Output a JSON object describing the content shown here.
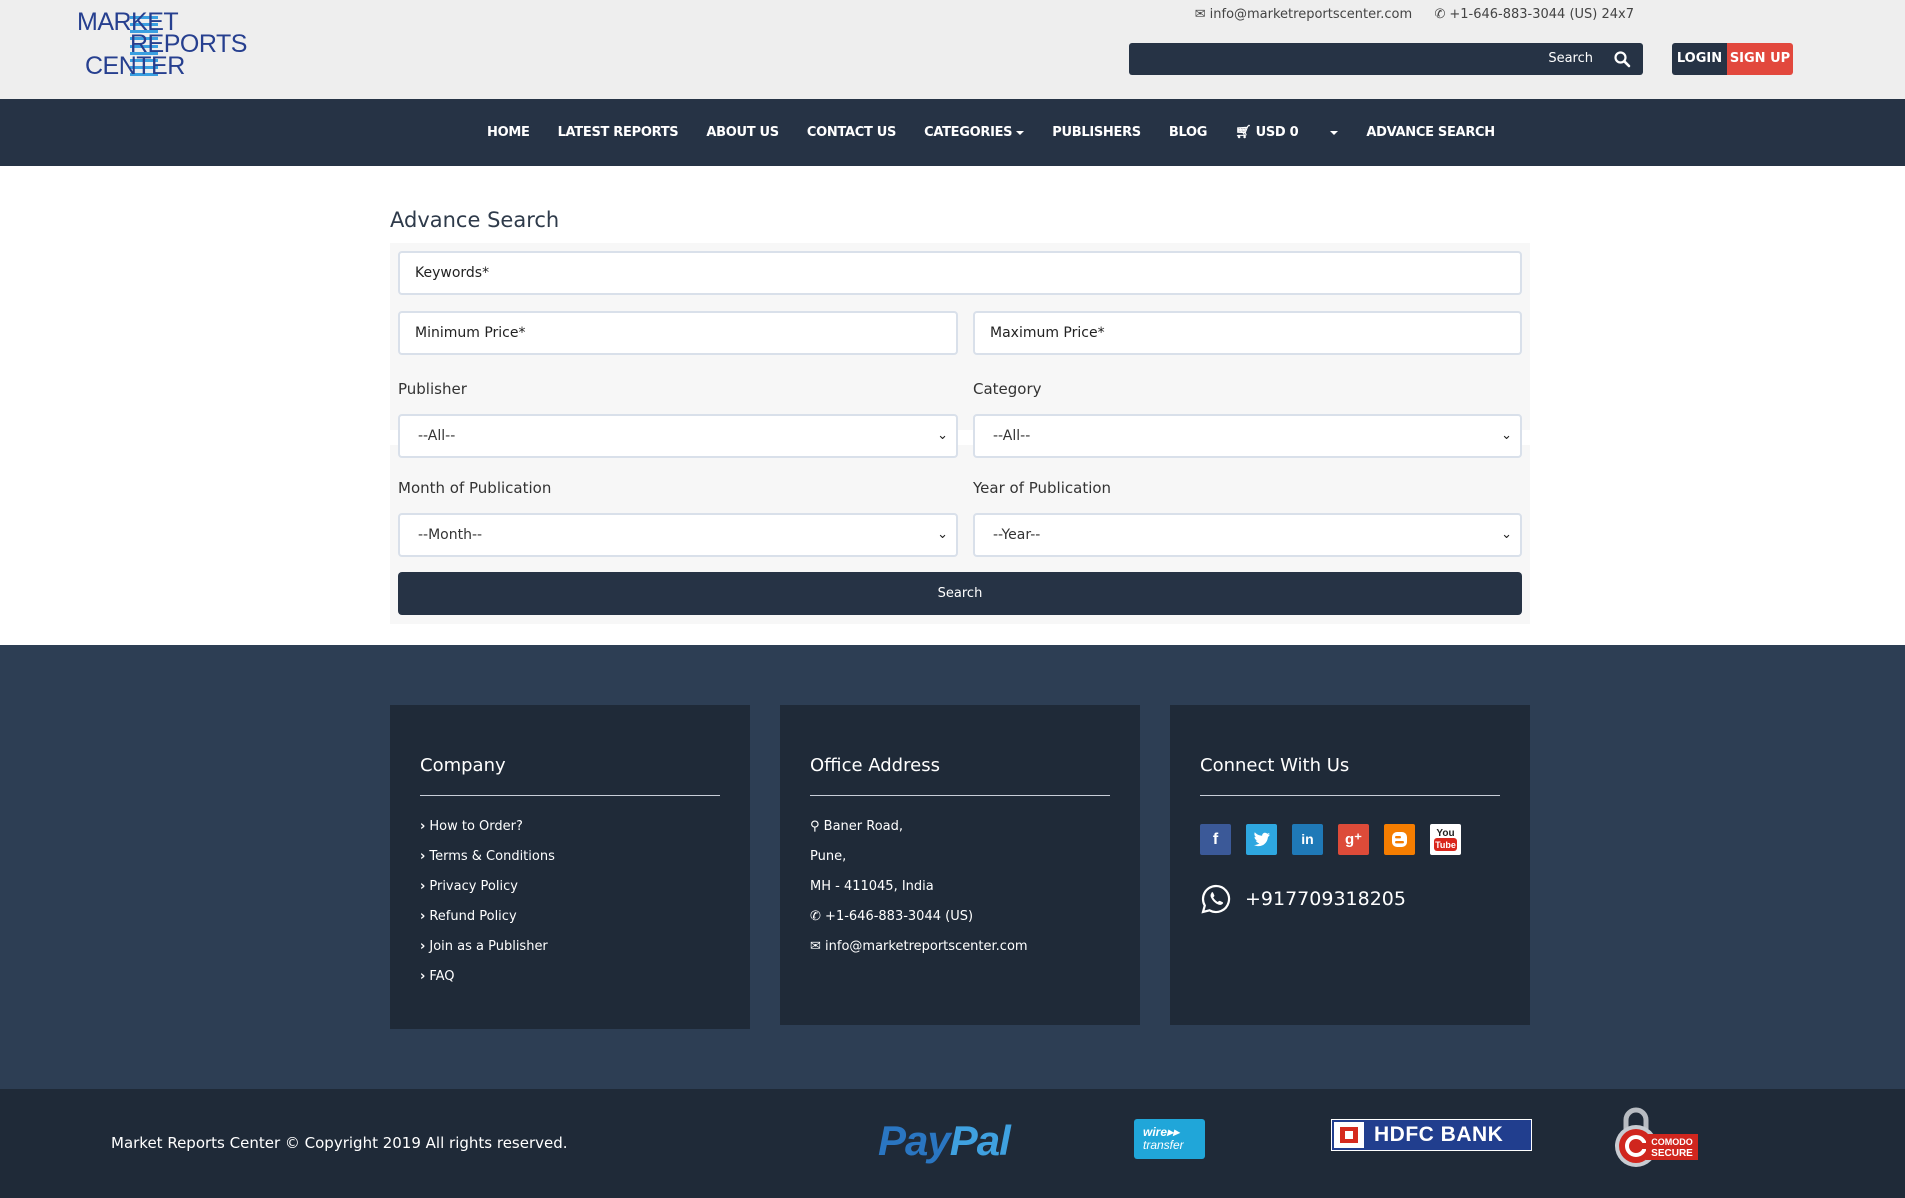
{
  "header": {
    "logo": {
      "line1": "MARKET",
      "line2": "REPORTS",
      "line3": "CENTER"
    },
    "email": "info@marketreportscenter.com",
    "phone": "+1-646-883-3044 (US) 24x7",
    "search_label": "Search",
    "search_placeholder": "",
    "login_label": "LOGIN",
    "signup_label": "SIGN UP"
  },
  "nav": {
    "home": "HOME",
    "latest_reports": "LATEST REPORTS",
    "about_us": "ABOUT US",
    "contact_us": "CONTACT US",
    "categories": "CATEGORIES",
    "publishers": "PUBLISHERS",
    "blog": "BLOG",
    "cart": "USD 0",
    "advance_search": "ADVANCE SEARCH"
  },
  "form": {
    "title": "Advance Search",
    "keywords_placeholder": "Keywords*",
    "min_price_placeholder": "Minimum Price*",
    "max_price_placeholder": "Maximum Price*",
    "publisher_label": "Publisher",
    "publisher_value": "--All--",
    "category_label": "Category",
    "category_value": "--All--",
    "month_label": "Month of Publication",
    "month_value": "--Month--",
    "year_label": "Year of Publication",
    "year_value": "--Year--",
    "submit_label": "Search"
  },
  "footer": {
    "company": {
      "title": "Company",
      "links": [
        "How to Order?",
        "Terms & Conditions",
        "Privacy Policy",
        "Refund Policy",
        "Join as a Publisher",
        "FAQ"
      ]
    },
    "office": {
      "title": "Office Address",
      "line1": "Baner Road,",
      "line2": "Pune,",
      "line3": "MH - 411045, India",
      "phone": "+1-646-883-3044 (US)",
      "email": "info@marketreportscenter.com"
    },
    "connect": {
      "title": "Connect With Us",
      "social": [
        "facebook-icon",
        "twitter-icon",
        "linkedin-icon",
        "google-plus-icon",
        "blogger-icon",
        "youtube-icon"
      ],
      "whatsapp": "+917709318205"
    }
  },
  "bottom": {
    "copyright": "Market Reports Center © Copyright 2019 All rights reserved.",
    "paypal": {
      "pay": "Pay",
      "pal": "Pal"
    },
    "wire": {
      "line1": "wire",
      "line2": "transfer"
    },
    "hdfc": "HDFC BANK",
    "comodo": {
      "line1": "COMODO",
      "line2": "SECURE"
    }
  },
  "colors": {
    "navy": "#263345",
    "footer_bg": "#2d3e54",
    "card_bg": "#1f2a38",
    "accent_red": "#e2483d",
    "logo_blue": "#263f8f"
  }
}
